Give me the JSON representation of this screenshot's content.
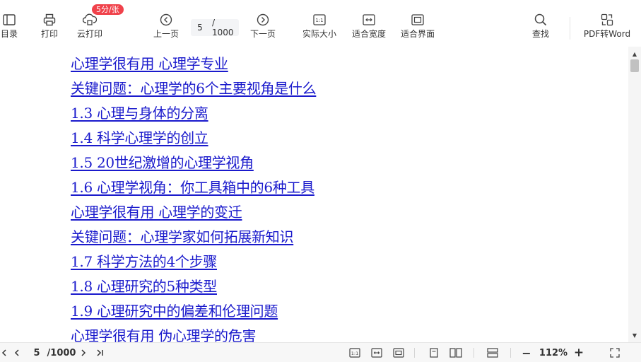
{
  "toolbar": {
    "toc_label": "目录",
    "print_label": "打印",
    "cloud_print_label": "云打印",
    "cloud_print_badge": "5分/张",
    "prev_page_label": "上一页",
    "current_page": "5",
    "page_total": "/ 1000",
    "next_page_label": "下一页",
    "actual_size_label": "实际大小",
    "fit_width_label": "适合宽度",
    "fit_page_label": "适合界面",
    "find_label": "查找",
    "pdf_to_word_label": "PDF转Word"
  },
  "document": {
    "toc_entries": [
      "心理学很有用  心理学专业",
      "关键问题：心理学的6个主要视角是什么",
      "1.3  心理与身体的分离",
      "1.4  科学心理学的创立",
      "1.5  20世纪激增的心理学视角",
      "1.6  心理学视角：你工具箱中的6种工具",
      "心理学很有用  心理学的变迁",
      "关键问题：心理学家如何拓展新知识",
      "1.7  科学方法的4个步骤",
      "1.8  心理研究的5种类型",
      "1.9  心理研究中的偏差和伦理问题",
      "心理学很有用  伪心理学的危害"
    ],
    "link_color": "#1a1acc"
  },
  "statusbar": {
    "current_page": "5",
    "page_total": "/1000",
    "zoom": "112%",
    "zoom_minus": "−",
    "zoom_plus": "+"
  },
  "colors": {
    "badge": "#f0424b",
    "toolbar_bg": "#ffffff",
    "statusbar_bg": "#f7f7f7"
  }
}
